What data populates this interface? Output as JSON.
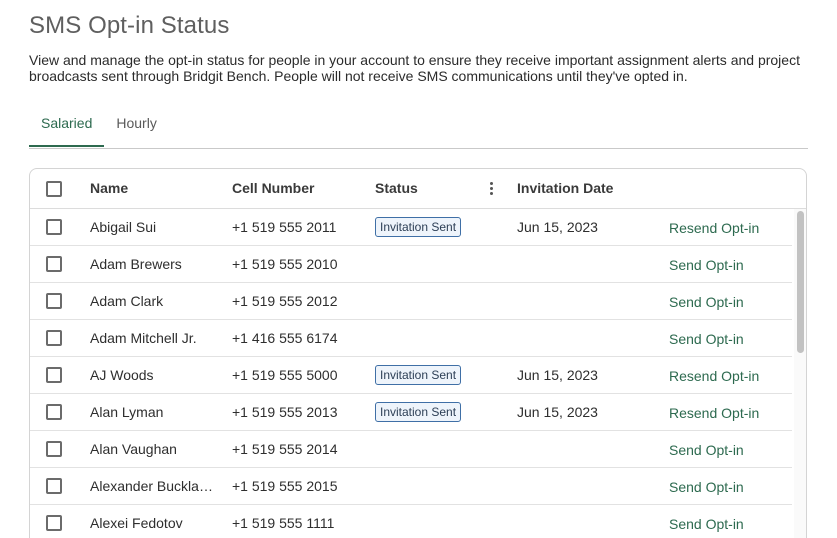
{
  "page": {
    "title": "SMS Opt-in Status",
    "description": "View and manage the opt-in status for people in your account to ensure they receive important assignment alerts and project broadcasts sent through Bridgit Bench. People will not receive SMS communications until they've opted in."
  },
  "tabs": [
    {
      "label": "Salaried",
      "active": true
    },
    {
      "label": "Hourly",
      "active": false
    }
  ],
  "table": {
    "columns": {
      "name": "Name",
      "cell_number": "Cell Number",
      "status": "Status",
      "invitation_date": "Invitation Date"
    },
    "rows": [
      {
        "name": "Abigail Sui",
        "cell": "+1 519 555 2011",
        "status": "Invitation Sent",
        "date": "Jun 15, 2023",
        "action": "Resend Opt-in"
      },
      {
        "name": "Adam Brewers",
        "cell": "+1 519 555 2010",
        "status": "",
        "date": "",
        "action": "Send Opt-in"
      },
      {
        "name": "Adam Clark",
        "cell": "+1 519 555 2012",
        "status": "",
        "date": "",
        "action": "Send Opt-in"
      },
      {
        "name": "Adam Mitchell Jr.",
        "cell": "+1 416 555 6174",
        "status": "",
        "date": "",
        "action": "Send Opt-in"
      },
      {
        "name": "AJ Woods",
        "cell": "+1 519 555 5000",
        "status": "Invitation Sent",
        "date": "Jun 15, 2023",
        "action": "Resend Opt-in"
      },
      {
        "name": "Alan Lyman",
        "cell": "+1 519 555 2013",
        "status": "Invitation Sent",
        "date": "Jun 15, 2023",
        "action": "Resend Opt-in"
      },
      {
        "name": "Alan Vaughan",
        "cell": "+1 519 555 2014",
        "status": "",
        "date": "",
        "action": "Send Opt-in"
      },
      {
        "name": "Alexander Buckla…",
        "cell": "+1 519 555 2015",
        "status": "",
        "date": "",
        "action": "Send Opt-in"
      },
      {
        "name": "Alexei Fedotov",
        "cell": "+1 519 555 1111",
        "status": "",
        "date": "",
        "action": "Send Opt-in"
      }
    ]
  },
  "colors": {
    "accent": "#2d6a4f",
    "badge_border": "#3f6fa6"
  }
}
